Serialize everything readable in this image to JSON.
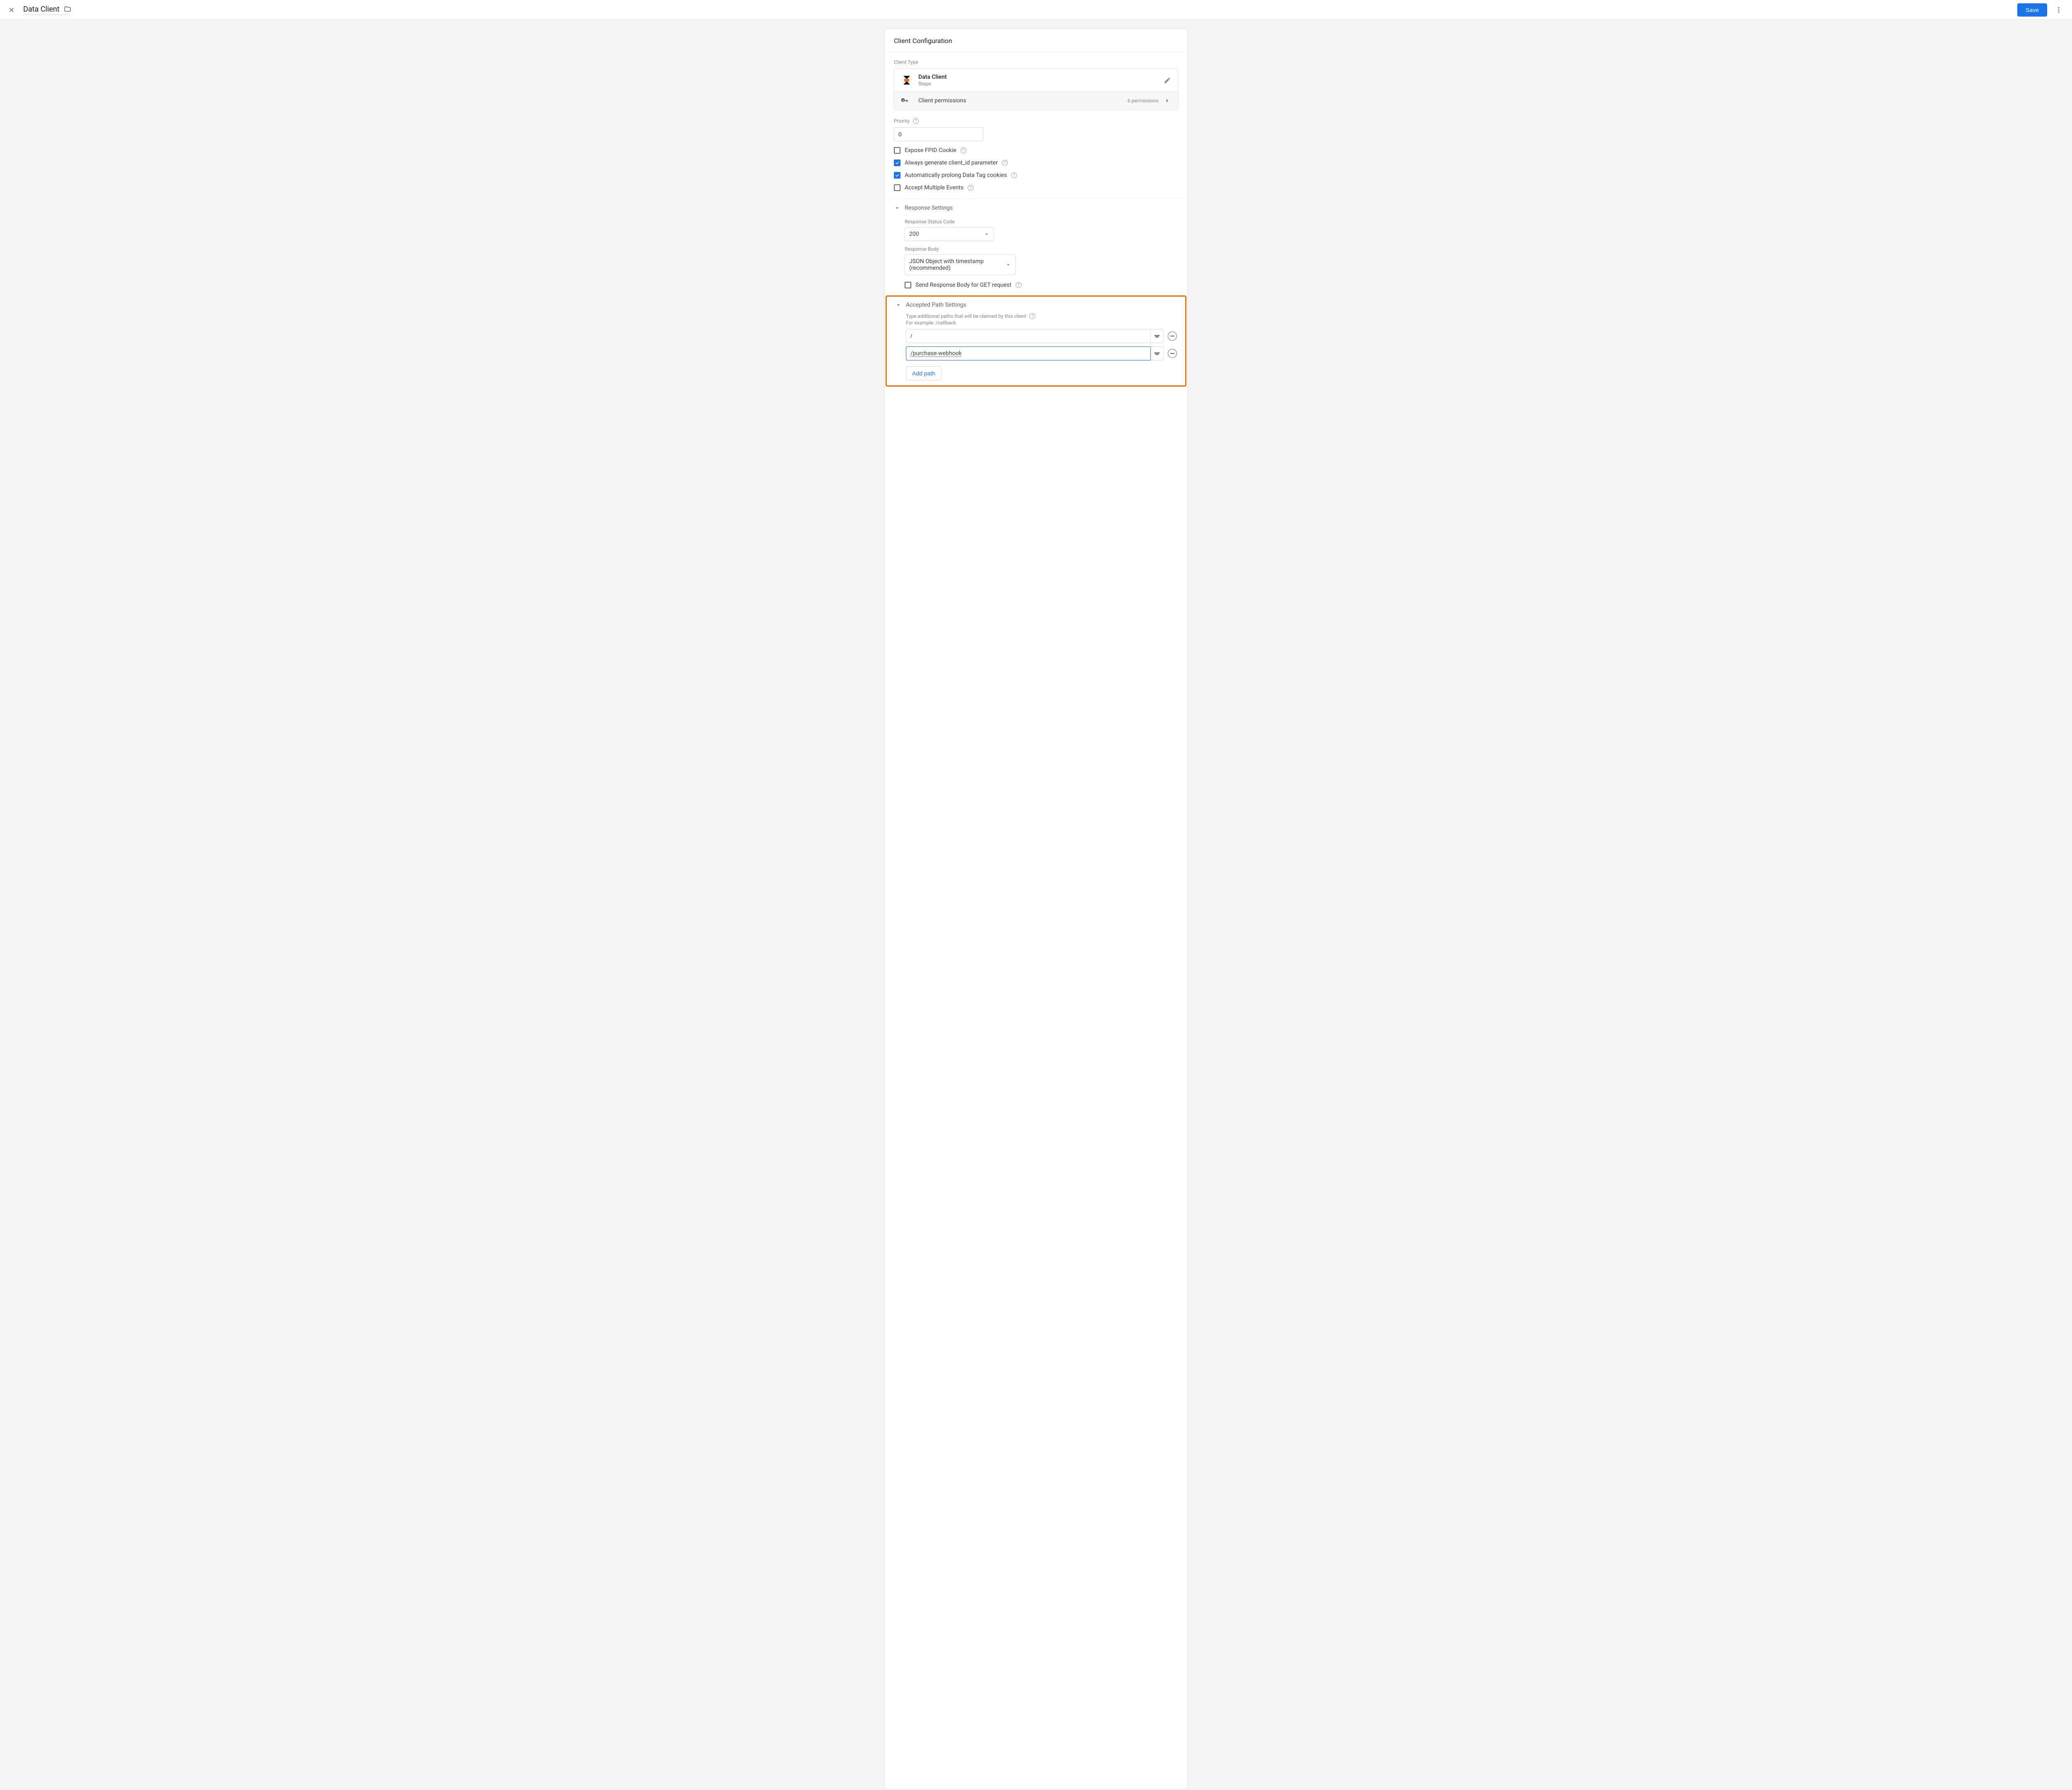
{
  "topbar": {
    "title": "Data Client",
    "save_label": "Save"
  },
  "card": {
    "header": "Client Configuration",
    "client_type": {
      "label": "Client Type",
      "name": "Data Client",
      "vendor": "Stape",
      "permissions_label": "Client permissions",
      "permissions_count": "6 permissions"
    },
    "priority": {
      "label": "Priority",
      "value": "0"
    },
    "checkboxes": {
      "expose_fpid": {
        "label": "Expose FPID Cookie",
        "checked": false
      },
      "generate_client_id": {
        "label": "Always generate client_id parameter",
        "checked": true
      },
      "prolong_cookies": {
        "label": "Automatically prolong Data Tag cookies",
        "checked": true
      },
      "accept_multiple": {
        "label": "Accept Multiple Events",
        "checked": false
      }
    },
    "response_settings": {
      "title": "Response Settings",
      "status_code_label": "Response Status Code",
      "status_code_value": "200",
      "body_label": "Response Body",
      "body_value": "JSON Object with timestamp (recommended)",
      "send_body_get": {
        "label": "Send Response Body for GET request",
        "checked": false
      }
    },
    "accepted_paths": {
      "title": "Accepted Path Settings",
      "help_text": "Type additional paths that will be claimed by this client",
      "example_text": "For example: /callback",
      "paths": [
        "/",
        "/purchase-webhook"
      ],
      "add_label": "Add path"
    }
  }
}
